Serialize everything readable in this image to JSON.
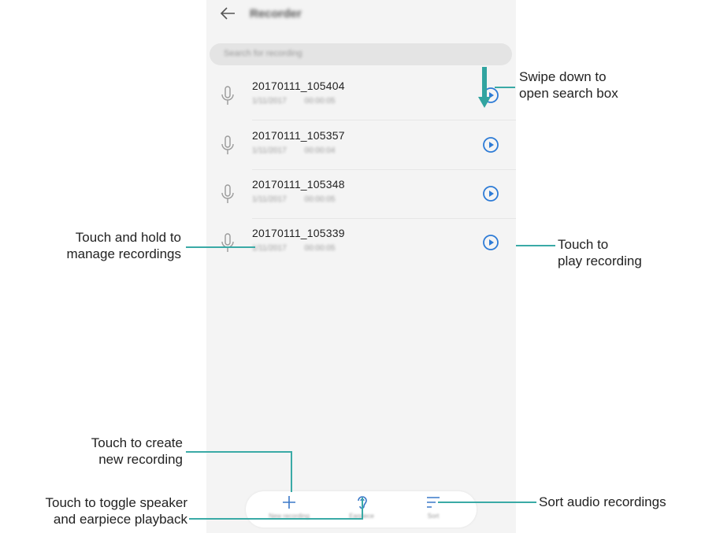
{
  "app": {
    "title": "Recorder",
    "search_placeholder": "Search for recording"
  },
  "recordings": [
    {
      "name": "20170111_105404",
      "date": "1/11/2017",
      "duration": "00:00:05"
    },
    {
      "name": "20170111_105357",
      "date": "1/11/2017",
      "duration": "00:00:04"
    },
    {
      "name": "20170111_105348",
      "date": "1/11/2017",
      "duration": "00:00:05"
    },
    {
      "name": "20170111_105339",
      "date": "1/11/2017",
      "duration": "00:00:05"
    }
  ],
  "bottom_bar": {
    "new_recording": "New recording",
    "earpiece": "Earpiece",
    "sort": "Sort"
  },
  "callouts": {
    "swipe_line1": "Swipe down to",
    "swipe_line2": "open search box",
    "hold_line1": "Touch and hold to",
    "hold_line2": "manage recordings",
    "play_line1": "Touch to",
    "play_line2": "play recording",
    "create_line1": "Touch to create",
    "create_line2": "new recording",
    "toggle_line1": "Touch to toggle speaker",
    "toggle_line2": "and earpiece playback",
    "sort_text": "Sort audio recordings"
  },
  "colors": {
    "accent": "#3aaaa6",
    "icon_blue": "#2d7bd6",
    "arrow": "#31a4a0"
  }
}
